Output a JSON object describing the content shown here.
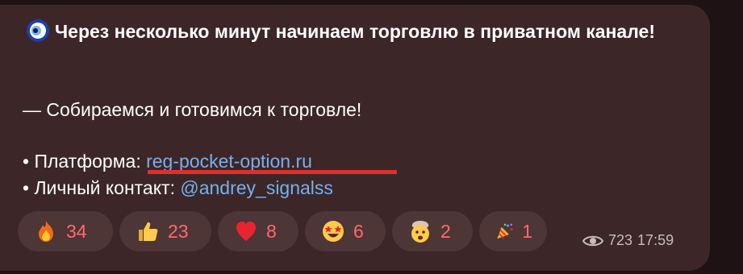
{
  "message": {
    "title": "Через несколько минут начинаем торговлю в приватном канале!",
    "line_prepare": "— Собираемся и готовимся к торговле!",
    "platform_label": "• Платформа: ",
    "platform_link": "reg-pocket-option.ru",
    "contact_label": "• Личный контакт: ",
    "contact_handle": "@andrey_signalss"
  },
  "reactions": [
    {
      "icon": "fire-emoji",
      "count": "34"
    },
    {
      "icon": "thumbs-up-emoji",
      "count": "23"
    },
    {
      "icon": "heart-emoji",
      "count": "8"
    },
    {
      "icon": "star-struck-emoji",
      "count": "6"
    },
    {
      "icon": "exploding-head-emoji",
      "count": "2"
    },
    {
      "icon": "party-popper-emoji",
      "count": "1"
    }
  ],
  "meta": {
    "views": "723",
    "time": "17:59"
  },
  "colors": {
    "background": "#1e1214",
    "bubble": "#3c2627",
    "link": "#74b1f0",
    "reaction_bg": "#4e3536",
    "reaction_count": "#ff6b6b",
    "annotation_underline": "#e0302b"
  }
}
